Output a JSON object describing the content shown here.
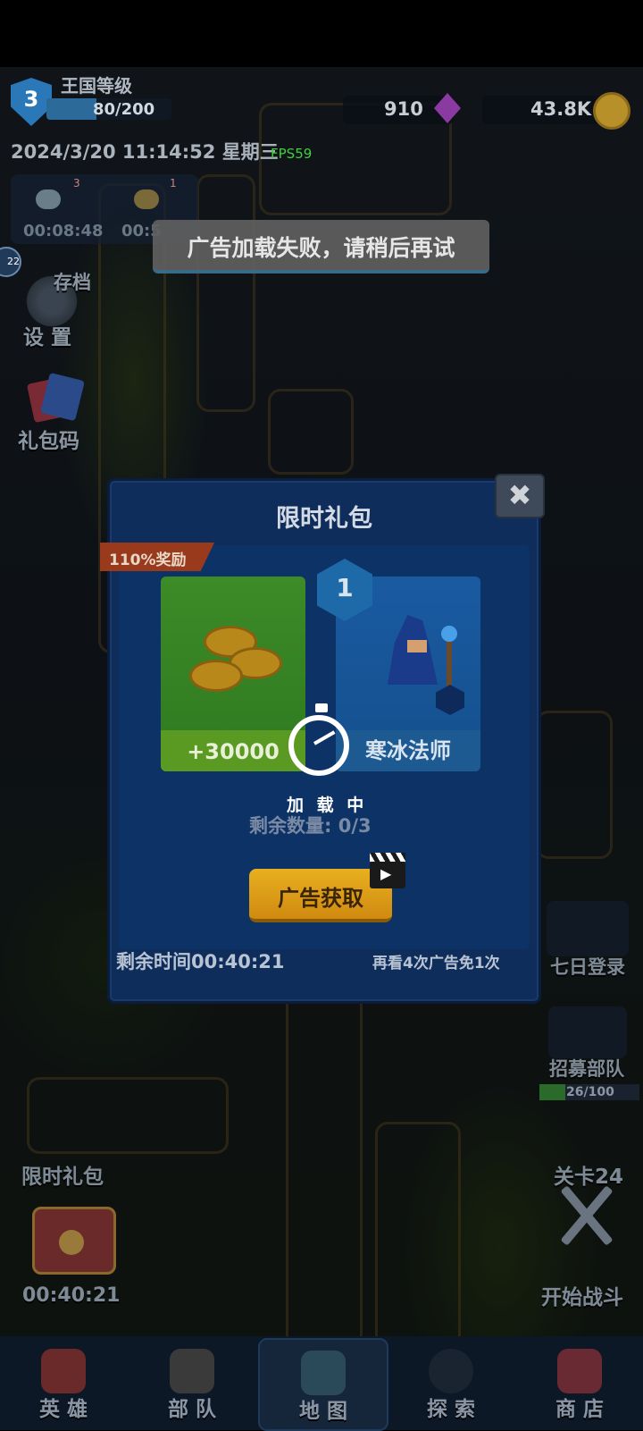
{
  "hud": {
    "kingdom_label": "王国等级",
    "level": "3",
    "exp": "80/200",
    "exp_fraction": 0.4,
    "gems": "910",
    "gold": "43.8K",
    "datetime": "2024/3/20 11:14:52 星期三",
    "fps": "FPS59"
  },
  "left_panel": {
    "timer1": "00:08:48",
    "timer1_badge": "3",
    "timer2": "00:5",
    "timer2_badge": "1",
    "side_count": "22",
    "save_label": "存档",
    "settings_label": "设 置",
    "giftcode_label": "礼包码"
  },
  "toast": "广告加载失败，请稍后再试",
  "dialog": {
    "title": "限时礼包",
    "bonus_ribbon": "110%奖励",
    "reward_gold": "+30000",
    "hero_level": "1",
    "hero_name": "寒冰法师",
    "loading_text": "加 载 中",
    "remaining_label": "剩余数量: 0/3",
    "ad_button": "广告获取",
    "time_left": "剩余时间00:40:21",
    "ad_hint": "再看4次广告免1次",
    "close_icon": "close-icon"
  },
  "right_panel": {
    "seven_day_label": "七日登录",
    "recruit_label": "招募部队",
    "recruit_progress": "26/100",
    "recruit_fraction": 0.26,
    "stage_label": "关卡24",
    "start_battle_label": "开始战斗"
  },
  "bottom_left": {
    "gift_label": "限时礼包",
    "gift_timer": "00:40:21"
  },
  "nav": [
    {
      "label": "英 雄",
      "icon": "hero-icon"
    },
    {
      "label": "部 队",
      "icon": "troops-icon"
    },
    {
      "label": "地 图",
      "icon": "map-icon"
    },
    {
      "label": "探 索",
      "icon": "explore-icon"
    },
    {
      "label": "商 店",
      "icon": "shop-icon"
    }
  ],
  "colors": {
    "dialog_bg": "#0f2d5a",
    "ad_button": "#e8b020",
    "fps": "#3fcf3f"
  }
}
